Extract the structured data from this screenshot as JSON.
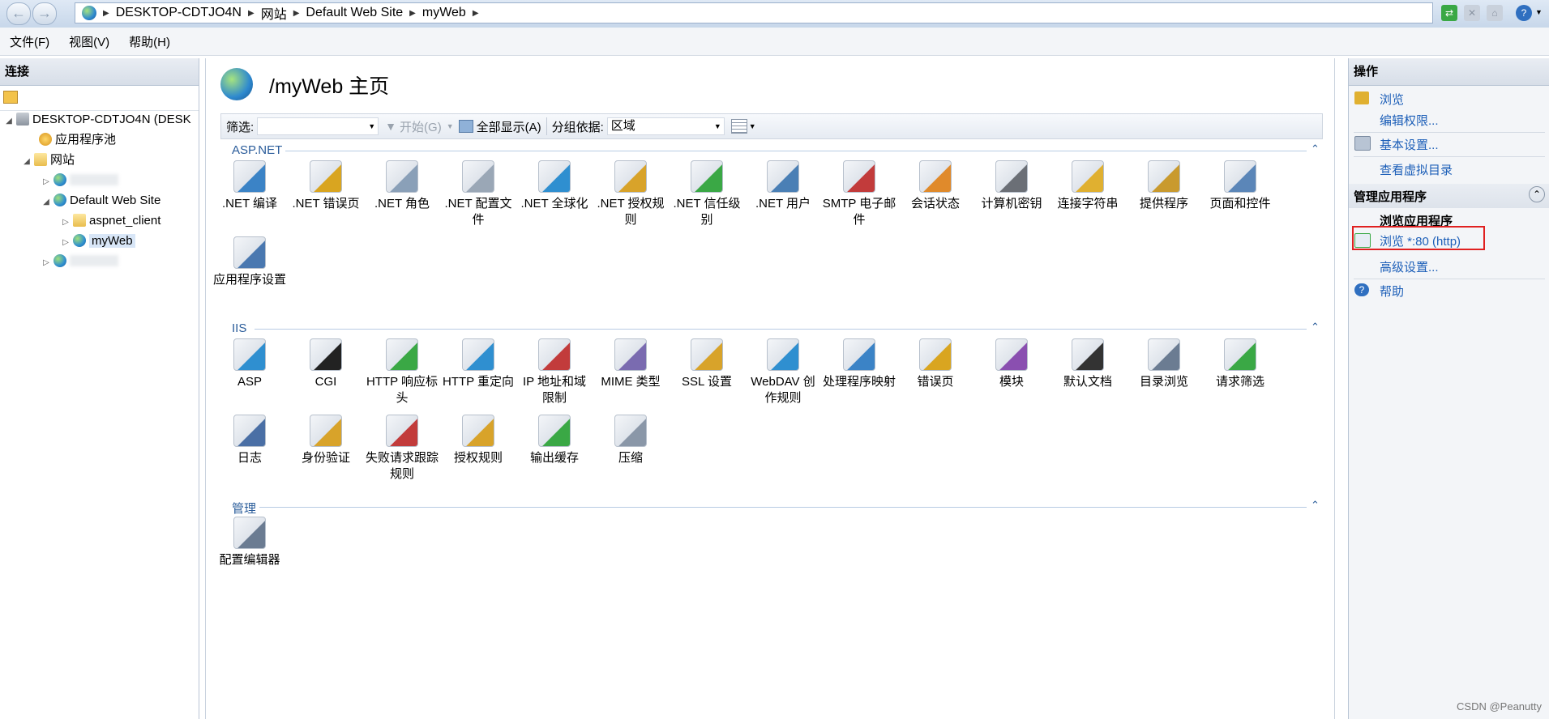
{
  "address": {
    "segments": [
      "DESKTOP-CDTJO4N",
      "网站",
      "Default Web Site",
      "myWeb"
    ]
  },
  "menu": [
    "文件(F)",
    "视图(V)",
    "帮助(H)"
  ],
  "connections": {
    "title": "连接",
    "tree": {
      "server": "DESKTOP-CDTJO4N (DESK",
      "app_pools": "应用程序池",
      "sites": "网站",
      "default_site": "Default Web Site",
      "aspnet_client": "aspnet_client",
      "myweb": "myWeb"
    }
  },
  "main": {
    "title": "/myWeb 主页",
    "filter": {
      "label": "筛选:",
      "go": "开始(G)",
      "show_all": "全部显示(A)",
      "group_by_label": "分组依据:",
      "group_by_value": "区域"
    },
    "groups": [
      {
        "name": "ASP.NET",
        "features": [
          {
            "label": ".NET 编译",
            "icon": "net-compile-icon",
            "color": "#3b83c6"
          },
          {
            "label": ".NET 错误页",
            "icon": "net-error-page-icon",
            "color": "#d9a520"
          },
          {
            "label": ".NET 角色",
            "icon": "net-roles-icon",
            "color": "#8aa0b8"
          },
          {
            "label": ".NET 配置文件",
            "icon": "net-profile-icon",
            "color": "#9aa7b6"
          },
          {
            "label": ".NET 全球化",
            "icon": "net-globalization-icon",
            "color": "#2f8fd0"
          },
          {
            "label": ".NET 授权规则",
            "icon": "net-authz-icon",
            "color": "#d8a32a"
          },
          {
            "label": ".NET 信任级别",
            "icon": "net-trust-icon",
            "color": "#3aa845"
          },
          {
            "label": ".NET 用户",
            "icon": "net-users-icon",
            "color": "#4a7fb5"
          },
          {
            "label": "SMTP 电子邮件",
            "icon": "smtp-email-icon",
            "color": "#c23b3b"
          },
          {
            "label": "会话状态",
            "icon": "session-state-icon",
            "color": "#e08a2b"
          },
          {
            "label": "计算机密钥",
            "icon": "machine-key-icon",
            "color": "#6b6f76"
          },
          {
            "label": "连接字符串",
            "icon": "connection-strings-icon",
            "color": "#e0b030"
          },
          {
            "label": "提供程序",
            "icon": "providers-icon",
            "color": "#c99a2e"
          },
          {
            "label": "页面和控件",
            "icon": "pages-controls-icon",
            "color": "#5b86b8"
          },
          {
            "label": "应用程序设置",
            "icon": "app-settings-icon",
            "color": "#4a78b0"
          }
        ]
      },
      {
        "name": "IIS",
        "features": [
          {
            "label": "ASP",
            "icon": "asp-icon",
            "color": "#2f8fd0"
          },
          {
            "label": "CGI",
            "icon": "cgi-icon",
            "color": "#222222"
          },
          {
            "label": "HTTP 响应标头",
            "icon": "http-headers-icon",
            "color": "#3aa845"
          },
          {
            "label": "HTTP 重定向",
            "icon": "http-redirect-icon",
            "color": "#2f8fd0"
          },
          {
            "label": "IP 地址和域限制",
            "icon": "ip-restrictions-icon",
            "color": "#c23b3b"
          },
          {
            "label": "MIME 类型",
            "icon": "mime-types-icon",
            "color": "#7a6bb0"
          },
          {
            "label": "SSL 设置",
            "icon": "ssl-settings-icon",
            "color": "#d8a32a"
          },
          {
            "label": "WebDAV 创作规则",
            "icon": "webdav-icon",
            "color": "#2f8fd0"
          },
          {
            "label": "处理程序映射",
            "icon": "handler-mappings-icon",
            "color": "#3b83c6"
          },
          {
            "label": "错误页",
            "icon": "error-pages-icon",
            "color": "#d9a520"
          },
          {
            "label": "模块",
            "icon": "modules-icon",
            "color": "#8a4fb0"
          },
          {
            "label": "默认文档",
            "icon": "default-document-icon",
            "color": "#333333"
          },
          {
            "label": "目录浏览",
            "icon": "directory-browsing-icon",
            "color": "#6b7c92"
          },
          {
            "label": "请求筛选",
            "icon": "request-filtering-icon",
            "color": "#3aa845"
          },
          {
            "label": "日志",
            "icon": "logging-icon",
            "color": "#4a6fa5"
          },
          {
            "label": "身份验证",
            "icon": "authentication-icon",
            "color": "#d8a32a"
          },
          {
            "label": "失败请求跟踪规则",
            "icon": "failed-request-tracing-icon",
            "color": "#c23b3b"
          },
          {
            "label": "授权规则",
            "icon": "authorization-rules-icon",
            "color": "#d8a32a"
          },
          {
            "label": "输出缓存",
            "icon": "output-caching-icon",
            "color": "#3aa845"
          },
          {
            "label": "压缩",
            "icon": "compression-icon",
            "color": "#8a97a8"
          }
        ]
      },
      {
        "name": "管理",
        "features": [
          {
            "label": "配置编辑器",
            "icon": "configuration-editor-icon",
            "color": "#6b7c92"
          }
        ]
      }
    ]
  },
  "actions": {
    "title": "操作",
    "browse": "浏览",
    "edit_permissions": "编辑权限...",
    "basic_settings": "基本设置...",
    "view_virtual_dirs": "查看虚拟目录",
    "manage_app_title": "管理应用程序",
    "browse_app_title": "浏览应用程序",
    "browse_http": "浏览 *:80 (http)",
    "advanced_settings": "高级设置...",
    "help": "帮助"
  },
  "watermark": "CSDN @Peanutty",
  "colors": {
    "link": "#1d5fb8",
    "group_header": "#2a5c9a",
    "highlight_border": "#e02020"
  }
}
